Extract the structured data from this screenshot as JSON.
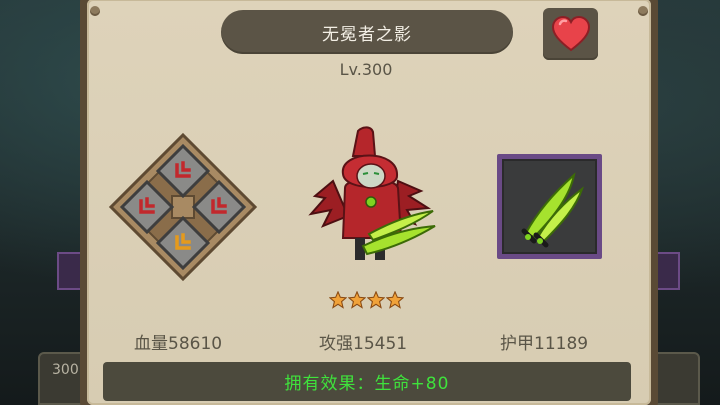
{
  "hero": {
    "name": "无冕者之影",
    "level": "Lv.300",
    "star_count": 4,
    "stars_max": 4
  },
  "stats": {
    "hp_label": "血量58610",
    "attack_label": "攻强15451",
    "armor_label": "护甲11189"
  },
  "effect": {
    "text": "拥有效果：生命+80"
  },
  "background": {
    "left_label": "300"
  },
  "icons": {
    "favorite": "heart-icon",
    "rune": "rune-emblem-icon",
    "weapon": "twin-blades-icon"
  },
  "colors": {
    "effect_text": "#3fe23c",
    "heart": "#e8434a",
    "weapon_frame": "#6a4a86",
    "star": "#f0a23a"
  }
}
